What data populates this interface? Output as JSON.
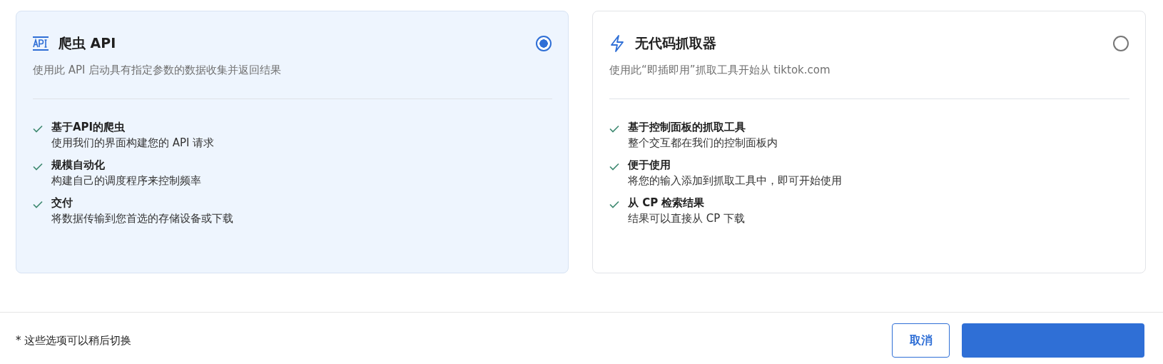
{
  "options": [
    {
      "title": "爬虫 API",
      "description": "使用此 API 启动具有指定参数的数据收集并返回结果",
      "selected": true,
      "features": [
        {
          "title": "基于API的爬虫",
          "text": "使用我们的界面构建您的 API 请求"
        },
        {
          "title": "规模自动化",
          "text": "构建自己的调度程序来控制频率"
        },
        {
          "title": "交付",
          "text": "将数据传输到您首选的存储设备或下载"
        }
      ]
    },
    {
      "title": "无代码抓取器",
      "description": "使用此“即插即用”抓取工具开始从 tiktok.com",
      "selected": false,
      "features": [
        {
          "title": "基于控制面板的抓取工具",
          "text": "整个交互都在我们的控制面板内"
        },
        {
          "title": "便于使用",
          "text": "将您的输入添加到抓取工具中，即可开始使用"
        },
        {
          "title": "从 CP 检索结果",
          "text": "结果可以直接从 CP 下载"
        }
      ]
    }
  ],
  "footer": {
    "note": "* 这些选项可以稍后切换",
    "cancel": "取消"
  }
}
